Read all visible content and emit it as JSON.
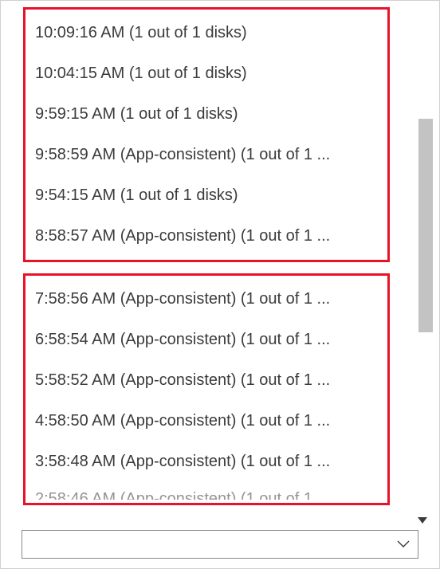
{
  "recoveryPoints": {
    "group1": [
      "10:09:16 AM (1 out of 1 disks)",
      "10:04:15 AM (1 out of 1 disks)",
      "9:59:15 AM (1 out of 1 disks)",
      "9:58:59 AM (App-consistent) (1 out of 1 ...",
      "9:54:15 AM (1 out of 1 disks)",
      "8:58:57 AM (App-consistent) (1 out of 1 ..."
    ],
    "group2": [
      "7:58:56 AM (App-consistent) (1 out of 1 ...",
      "6:58:54 AM (App-consistent) (1 out of 1 ...",
      "5:58:52 AM (App-consistent) (1 out of 1 ...",
      "4:58:50 AM (App-consistent) (1 out of 1 ...",
      "3:58:48 AM (App-consistent) (1 out of 1 ..."
    ],
    "partial": "2:58:46 AM (App-consistent) (1 out of 1 ..."
  },
  "dropdown": {
    "value": ""
  }
}
